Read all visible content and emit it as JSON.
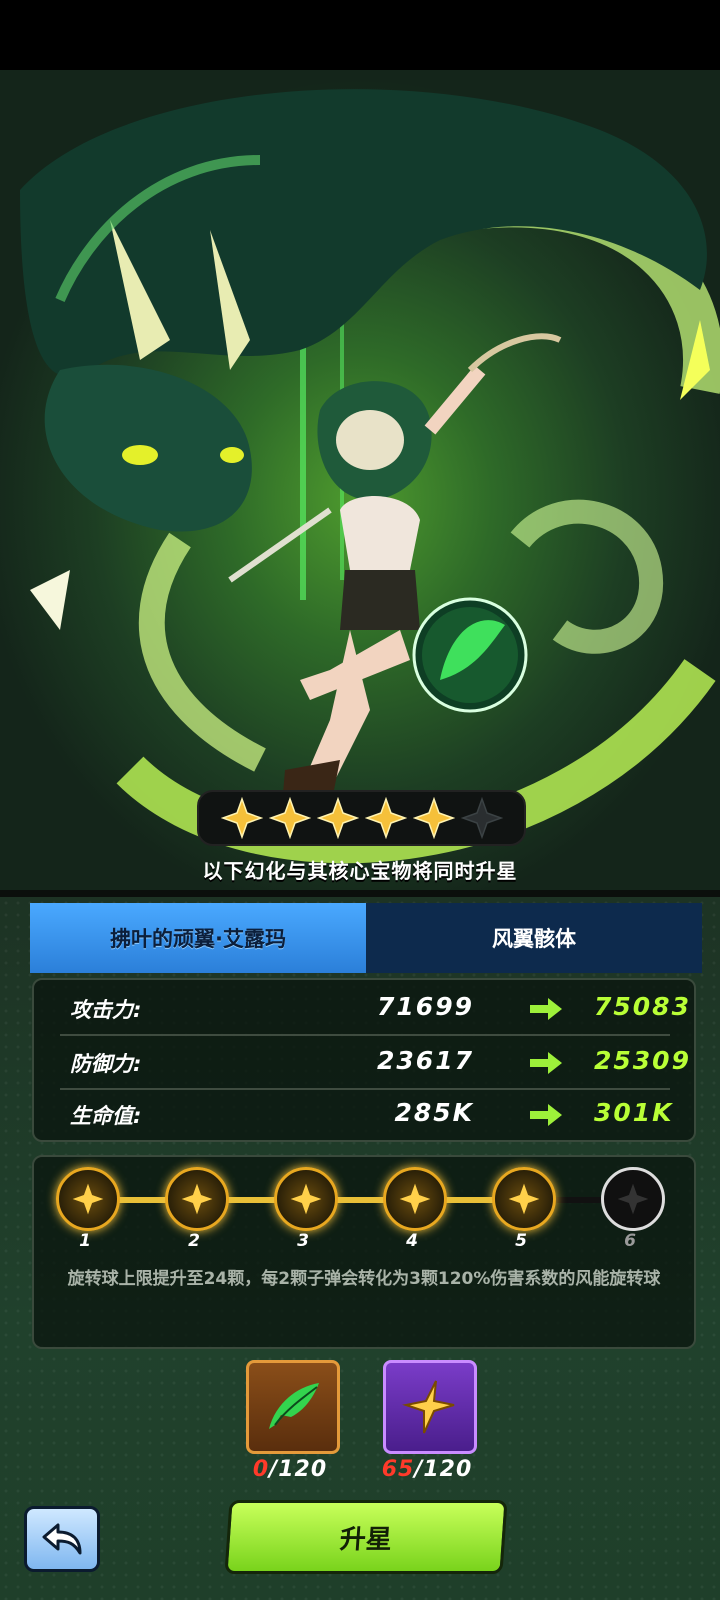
{
  "hero": {
    "stars_total": 6,
    "stars_filled": 5
  },
  "subtitle": "以下幻化与其核心宝物将同时升星",
  "tabs": [
    {
      "label": "拂叶的顽翼·艾露玛"
    },
    {
      "label": "风翼骸体"
    }
  ],
  "stats": [
    {
      "label": "攻击力:",
      "current": "71699",
      "next": "75083"
    },
    {
      "label": "防御力:",
      "current": "23617",
      "next": "25309"
    },
    {
      "label": "生命值:",
      "current": "285K",
      "next": "301K"
    }
  ],
  "progress": {
    "nodes": [
      "1",
      "2",
      "3",
      "4",
      "5",
      "6"
    ],
    "completed": 5,
    "description": "旋转球上限提升至24颗，每2颗子弹会转化为3颗120%伤害系数的风能旋转球"
  },
  "materials": [
    {
      "icon": "green-wing-icon",
      "have": "0",
      "need": "/120"
    },
    {
      "icon": "gold-star-crystal-icon",
      "have": "65",
      "need": "/120"
    }
  ],
  "buttons": {
    "upgrade": "升星"
  },
  "colors": {
    "accent_green": "#b9ff36",
    "tab_active": "#4aa9ff",
    "tab_inactive": "#0d2a4d",
    "star_gold": "#f5c03a",
    "deficit_red": "#ff3a2a"
  }
}
